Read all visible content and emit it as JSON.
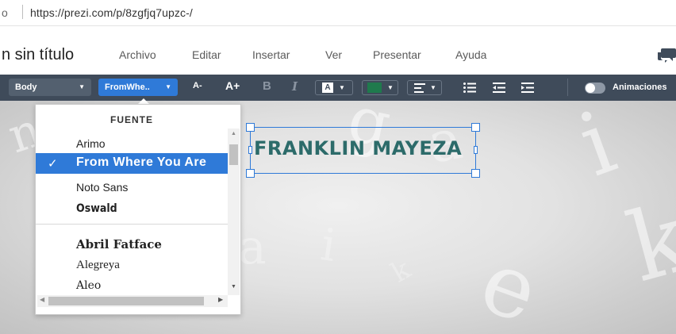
{
  "browser": {
    "url_prefix": "o",
    "url": "https://prezi.com/p/8zgfjq7upzc-/"
  },
  "app": {
    "title": "n sin título",
    "menu": [
      {
        "label": "Archivo"
      },
      {
        "label": "Editar"
      },
      {
        "label": "Insertar"
      },
      {
        "label": "Ver"
      },
      {
        "label": "Presentar"
      },
      {
        "label": "Ayuda"
      }
    ]
  },
  "toolbar": {
    "style_value": "Body",
    "font_value": "FromWhe..",
    "decrease_size": "A-",
    "increase_size": "A+",
    "bold": "B",
    "italic": "I",
    "bg_color_glyph": "A",
    "text_color": "#1f7a4d",
    "animations_label": "Animaciones",
    "animations_on": false
  },
  "font_panel": {
    "header": "FUENTE",
    "fonts": [
      {
        "name": "Arimo",
        "selected": false
      },
      {
        "name": "From Where You Are",
        "selected": true
      },
      {
        "name": "Noto Sans",
        "selected": false
      },
      {
        "name": "Oswald",
        "selected": false
      },
      {
        "name": "Abril Fatface",
        "selected": false
      },
      {
        "name": "Alegreya",
        "selected": false
      },
      {
        "name": "Aleo",
        "selected": false
      }
    ],
    "check_glyph": "✓"
  },
  "canvas": {
    "textbox_text": "FRANKLIN MAYEZA",
    "text_color": "#2c6b6a",
    "selection_color": "#2f7ad8"
  },
  "colors": {
    "toolbar_bg": "#3f4b5a",
    "accent": "#2f7ad8"
  }
}
